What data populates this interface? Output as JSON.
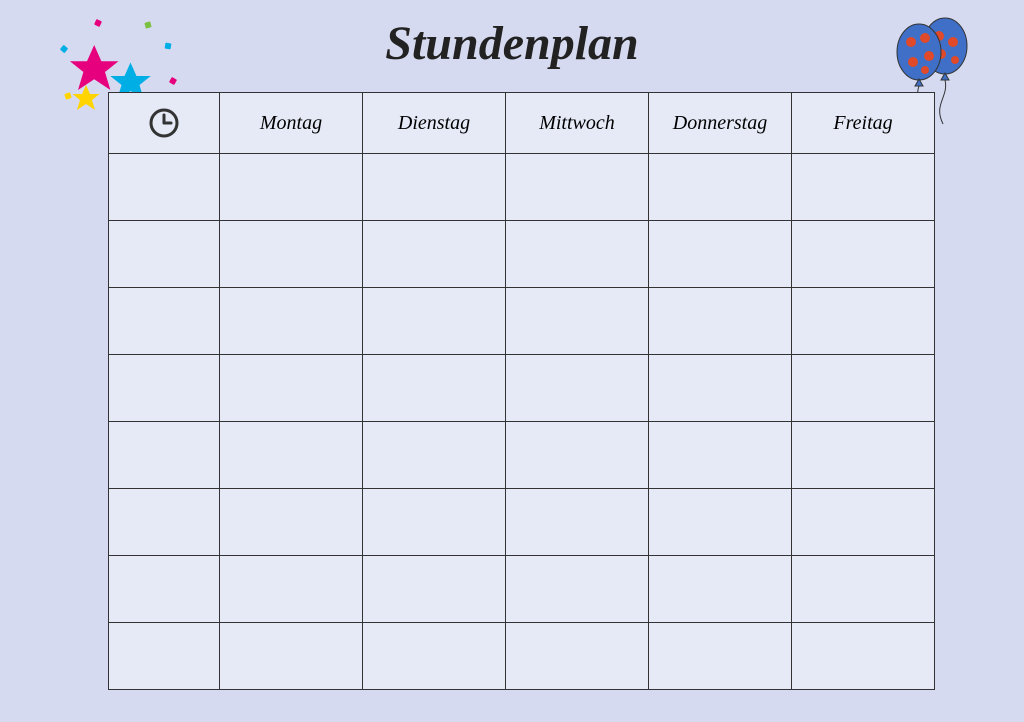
{
  "title": "Stundenplan",
  "columns": {
    "time_icon": "clock-icon",
    "days": [
      "Montag",
      "Dienstag",
      "Mittwoch",
      "Donnerstag",
      "Freitag"
    ]
  },
  "rows": 8,
  "cells": [
    [
      "",
      "",
      "",
      "",
      "",
      ""
    ],
    [
      "",
      "",
      "",
      "",
      "",
      ""
    ],
    [
      "",
      "",
      "",
      "",
      "",
      ""
    ],
    [
      "",
      "",
      "",
      "",
      "",
      ""
    ],
    [
      "",
      "",
      "",
      "",
      "",
      ""
    ],
    [
      "",
      "",
      "",
      "",
      "",
      ""
    ],
    [
      "",
      "",
      "",
      "",
      "",
      ""
    ],
    [
      "",
      "",
      "",
      "",
      "",
      ""
    ]
  ],
  "decor": {
    "stars": {
      "colors": [
        "#e6007e",
        "#00aee6",
        "#ffd400"
      ],
      "confetti_colors": [
        "#e6007e",
        "#00aee6",
        "#ffd400",
        "#7ac142"
      ]
    },
    "balloons": {
      "body_color": "#3f6fc7",
      "spot_color": "#e04a2a"
    }
  }
}
